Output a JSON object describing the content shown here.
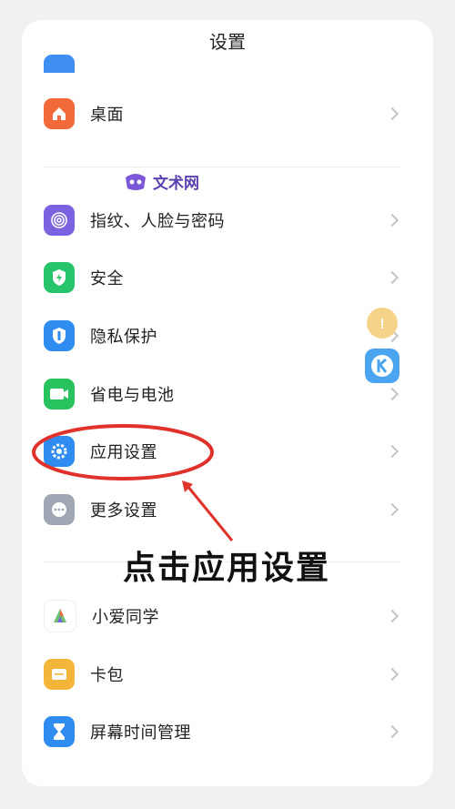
{
  "header": {
    "title": "设置"
  },
  "rows": [
    {
      "label": "桌面"
    },
    {
      "label": "指纹、人脸与密码"
    },
    {
      "label": "安全"
    },
    {
      "label": "隐私保护"
    },
    {
      "label": "省电与电池"
    },
    {
      "label": "应用设置"
    },
    {
      "label": "更多设置"
    },
    {
      "label": "小爱同学"
    },
    {
      "label": "卡包"
    },
    {
      "label": "屏幕时间管理"
    }
  ],
  "watermark": {
    "text": "文术网"
  },
  "annotation": {
    "text": "点击应用设置"
  },
  "colors": {
    "desktop": "#f36a3a",
    "fingerprint": "#7a62e0",
    "security": "#27c46b",
    "privacy": "#2f8cf0",
    "battery": "#28c35e",
    "app_settings": "#2f8cf0",
    "more": "#9ea7b3",
    "wallet": "#f3b63a",
    "screen_time": "#2f8cf0",
    "highlight": "#e0312b"
  }
}
